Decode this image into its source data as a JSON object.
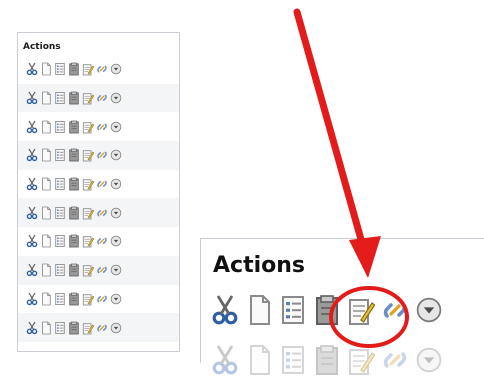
{
  "left_panel": {
    "title": "Actions"
  },
  "zoom_panel": {
    "title": "Actions"
  },
  "row_count": 10,
  "icons": [
    "cut-icon",
    "copy-icon",
    "list-icon",
    "archive-icon",
    "edit-icon",
    "link-icon",
    "dropdown-icon"
  ],
  "colors": {
    "annotation": "#e41b1b",
    "border": "#c9cdd3",
    "alt_row": "#f4f5f7"
  }
}
